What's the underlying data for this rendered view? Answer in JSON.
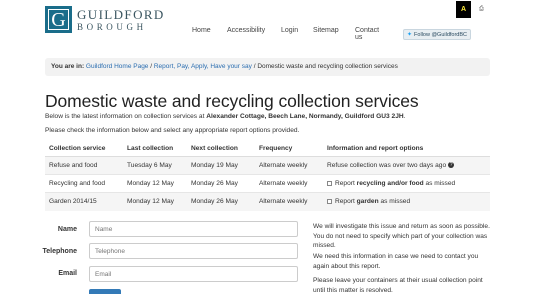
{
  "header": {
    "logo_letter": "G",
    "logo_line1": "GUILDFORD",
    "logo_line2": "BOROUGH",
    "nav": [
      "Home",
      "Accessibility",
      "Login",
      "Sitemap",
      "Contact us"
    ],
    "twitter_label": "Follow @GuildfordBC",
    "a11y_label": "A"
  },
  "breadcrumb": {
    "prefix": "You are in:",
    "home": "Guildford Home Page",
    "sep": " / ",
    "section": "Report, Pay, Apply, Have your say",
    "current": "Domestic waste and recycling collection services"
  },
  "page": {
    "title": "Domestic waste and recycling collection services",
    "intro_text": "Below is the latest information on collection services at ",
    "address": "Alexander Cottage, Beech Lane, Normandy, Guildford GU3 2JH",
    "intro_end": ".",
    "check_text": "Please check the information below and select any appropriate report options provided."
  },
  "table": {
    "headers": [
      "Collection service",
      "Last collection",
      "Next collection",
      "Frequency",
      "Information and report options"
    ],
    "rows": [
      {
        "service": "Refuse and food",
        "last": "Tuesday 6 May",
        "next": "Monday 19 May",
        "freq": "Alternate weekly",
        "info": "Refuse collection was over two days ago"
      },
      {
        "service": "Recycling and food",
        "last": "Monday 12 May",
        "next": "Monday 26 May",
        "freq": "Alternate weekly",
        "report_pre": "Report ",
        "report_bold": "recycling and/or food",
        "report_post": " as missed"
      },
      {
        "service": "Garden 2014/15",
        "last": "Monday 12 May",
        "next": "Monday 26 May",
        "freq": "Alternate weekly",
        "report_pre": "Report ",
        "report_bold": "garden",
        "report_post": " as missed"
      }
    ]
  },
  "form": {
    "name_label": "Name",
    "name_placeholder": "Name",
    "tel_label": "Telephone",
    "tel_placeholder": "Telephone",
    "email_label": "Email",
    "email_placeholder": "Email"
  },
  "side": {
    "p1": "We will investigate this issue and return as soon as possible. You do not need to specify which part of your collection was missed.",
    "p2": "We need this information in case we need to contact you again about this report.",
    "p3": "Please leave your containers at their usual collection point until this matter is resolved."
  }
}
